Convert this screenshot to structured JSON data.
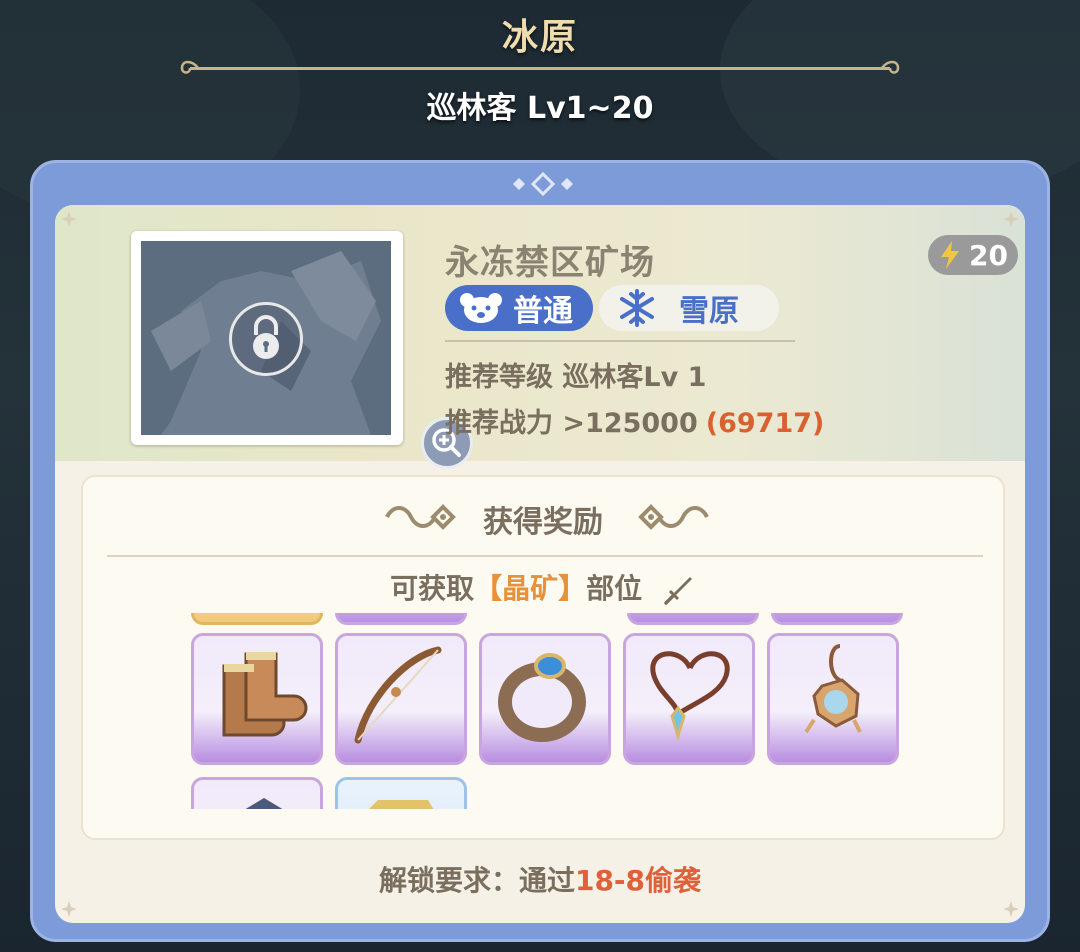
{
  "header": {
    "region_title": "冰原",
    "subtitle": "巡林客 Lv1~20"
  },
  "stage": {
    "name": "永冻禁区矿场",
    "energy_cost": "20",
    "portrait_locked": true,
    "tags": [
      {
        "label": "普通",
        "icon": "bear-face-icon"
      },
      {
        "label": "雪原",
        "icon": "snowflake-icon"
      }
    ],
    "recommended_level": "推荐等级 巡林客Lv 1",
    "recommended_power_label": "推荐战力 >125000",
    "current_power": "(69717)"
  },
  "rewards": {
    "title": "获得奖励",
    "obtain_prefix": "可获取",
    "obtain_highlight": "【晶矿】",
    "obtain_suffix": "部位",
    "items": [
      {
        "name": "boots",
        "rarity": "purple"
      },
      {
        "name": "bow",
        "rarity": "purple"
      },
      {
        "name": "ring",
        "rarity": "purple"
      },
      {
        "name": "necklace",
        "rarity": "purple"
      },
      {
        "name": "amulet",
        "rarity": "purple"
      },
      {
        "name": "item-row3-1",
        "rarity": "purple"
      },
      {
        "name": "item-row3-2",
        "rarity": "blue"
      }
    ]
  },
  "unlock": {
    "label": "解锁要求：通过",
    "requirement": "18-8偷袭"
  },
  "colors": {
    "frame": "#7d9bd8",
    "panel": "#f6f1e6",
    "tag_blue": "#4a6fc9",
    "highlight_orange": "#e7913a",
    "power_red": "#d9602f"
  }
}
